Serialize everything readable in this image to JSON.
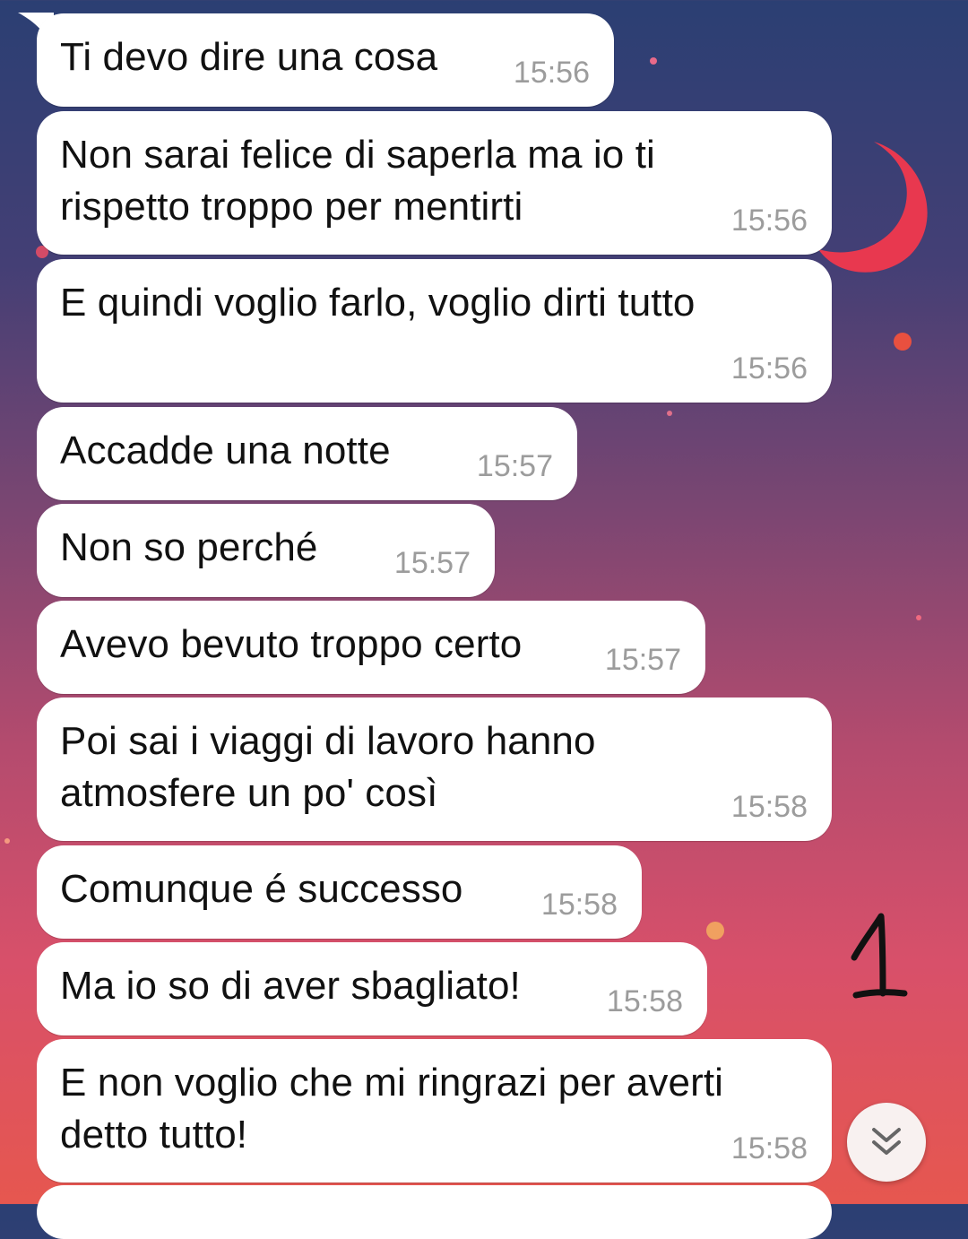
{
  "chat": {
    "messages": [
      {
        "text": "Ti devo dire una cosa",
        "time": "15:56"
      },
      {
        "text": "Non sarai felice di saperla ma io ti\nrispetto troppo per mentirti",
        "time": "15:56"
      },
      {
        "text": "E quindi voglio farlo, voglio dirti tutto",
        "time": "15:56"
      },
      {
        "text": "Accadde una notte",
        "time": "15:57"
      },
      {
        "text": "Non so perché",
        "time": "15:57"
      },
      {
        "text": "Avevo bevuto troppo certo",
        "time": "15:57"
      },
      {
        "text": "Poi sai i viaggi di lavoro hanno\natmosfere un po' così",
        "time": "15:58"
      },
      {
        "text": "Comunque é successo",
        "time": "15:58"
      },
      {
        "text": "Ma io so di aver sbagliato!",
        "time": "15:58"
      },
      {
        "text": "E non voglio che mi ringrazi per averti\ndetto tutto!",
        "time": "15:58"
      }
    ]
  },
  "annotation": {
    "handwritten_mark": "1"
  },
  "scroll_button": {
    "icon": "double-chevron-down-icon"
  },
  "colors": {
    "bubble": "#ffffff",
    "timestamp": "#9c9c9c",
    "moon": "#e8384f"
  }
}
